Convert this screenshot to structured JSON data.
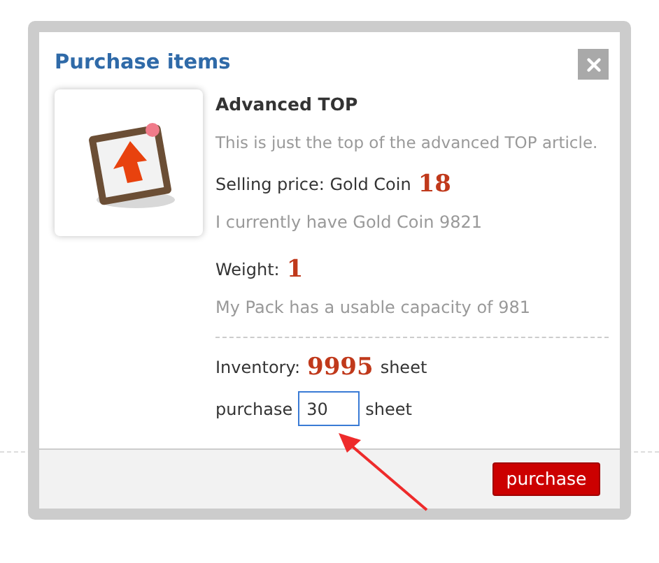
{
  "dialog": {
    "title": "Purchase items",
    "item": {
      "name": "Advanced TOP",
      "description": "This is just the top of the advanced TOP article.",
      "price_label": "Selling price: Gold Coin",
      "price": "18",
      "balance": "I currently have Gold Coin 9821",
      "weight_label": "Weight:",
      "weight": "1",
      "capacity": "My Pack has a usable capacity of 981",
      "inventory_label": "Inventory:",
      "inventory": "9995",
      "inventory_unit": "sheet",
      "purchase_label": "purchase",
      "quantity": "30",
      "purchase_unit": "sheet"
    },
    "button": "purchase"
  }
}
